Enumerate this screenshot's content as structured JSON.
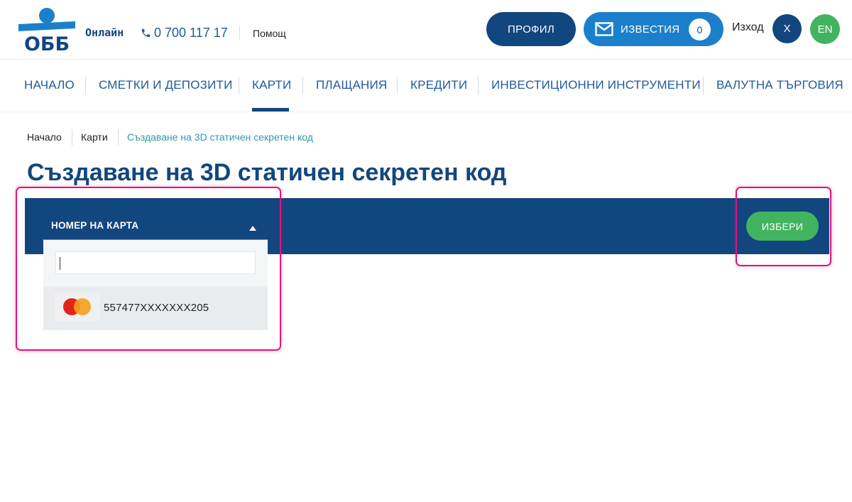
{
  "header": {
    "brand_sub": "Онлайн",
    "phone": "0 700 117 17",
    "help": "Помощ",
    "profile_label": "ПРОФИЛ",
    "notifications_label": "ИЗВЕСТИЯ",
    "notifications_count": "0",
    "logout": "Изход",
    "user_initial": "X",
    "language": "EN"
  },
  "nav": {
    "items": [
      "НАЧАЛО",
      "СМЕТКИ И ДЕПОЗИТИ",
      "КАРТИ",
      "ПЛАЩАНИЯ",
      "КРЕДИТИ",
      "ИНВЕСТИЦИОННИ ИНСТРУМЕНТИ",
      "ВАЛУТНА ТЪРГОВИЯ"
    ],
    "active": "КАРТИ"
  },
  "breadcrumb": [
    "Начало",
    "Карти",
    "Създаване на 3D статичен секретен код"
  ],
  "page_title": "Създаване на 3D статичен секретен код",
  "card_select": {
    "label": "НОМЕР НА КАРТА",
    "search_value": "",
    "options": [
      "557477XXXXXXX205"
    ]
  },
  "select_button": "ИЗБЕРИ",
  "colors": {
    "primary": "#12467f",
    "accent_blue": "#1c7fcb",
    "green": "#42b45f",
    "highlight": "#e0147e",
    "breadcrumb_current": "#2a9aa7"
  }
}
